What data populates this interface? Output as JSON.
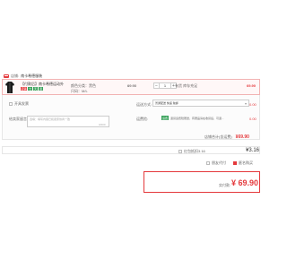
{
  "shop": {
    "label": "店铺:",
    "name": "南卡希德服装"
  },
  "item": {
    "title": "【付款后】南卡希德运动外套女春...",
    "badges": [
      "店铺",
      "七",
      "天",
      "退"
    ],
    "attrs": [
      "颜色分类：黑色",
      "尺码：M/L"
    ],
    "unit_price": "69.90",
    "quantity": "1",
    "minus": "−",
    "plus": "+",
    "stock": "有货 库存充足",
    "total": "69.90"
  },
  "options": {
    "invoice_label": "开具发票",
    "message_label": "给卖家留言:",
    "message_placeholder": "选填：填写内容已和卖家协商一致",
    "message_count": "0/200",
    "shipping_label": "运送方式:",
    "shipping_value": "普通配送 快递 免邮",
    "shipping_fee": "0.00",
    "service_label": "运费险:",
    "service_tag": "运费",
    "service_desc": "退货运费险赠送，有赠品请在收货后，可退...",
    "service_fee": "0.00",
    "subtotal_label": "店铺合计(含运费)",
    "subtotal_value": "¥69.90"
  },
  "coupon": {
    "label": "红包抵扣3.16",
    "value": "¥3.16"
  },
  "extras": {
    "anonymous": "匿名购买",
    "confirm": "朋友代付"
  },
  "pay": {
    "label": "实付款:",
    "amount": "¥ 69.90"
  },
  "colors": {
    "accent": "#e4393c",
    "green": "#3aa35c"
  }
}
